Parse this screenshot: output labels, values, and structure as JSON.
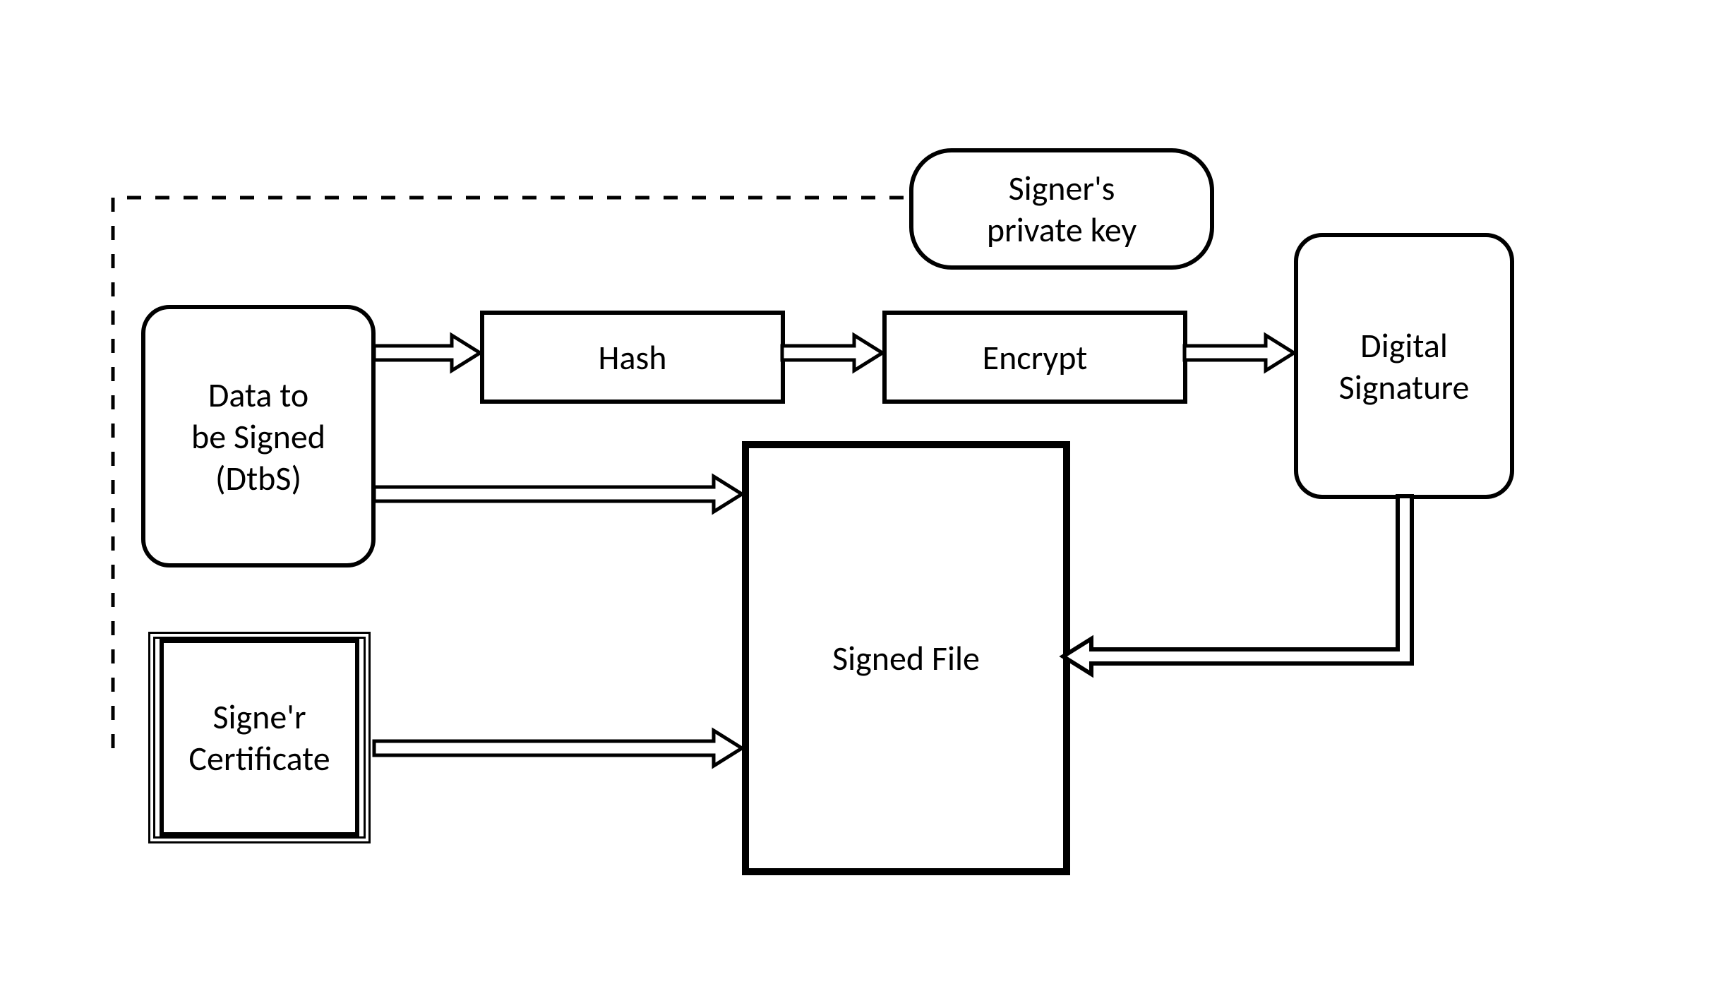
{
  "nodes": {
    "data_to_be_signed": "Data to\nbe Signed\n(DtbS)",
    "hash": "Hash",
    "encrypt": "Encrypt",
    "private_key": "Signer's\nprivate key",
    "digital_signature": "Digital\nSignature",
    "signed_file": "Signed File",
    "signer_certificate": "Signe'r\nCertificate"
  }
}
